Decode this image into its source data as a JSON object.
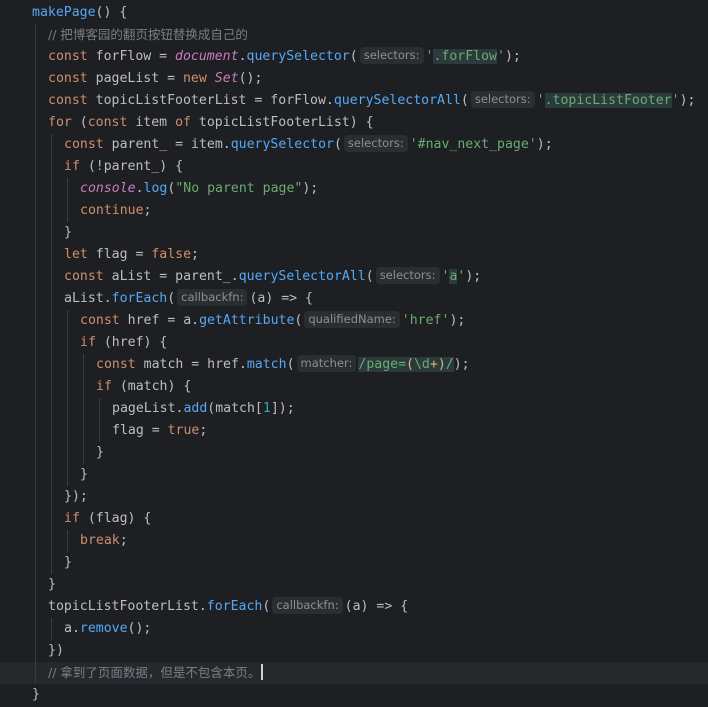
{
  "colors": {
    "background": "#1e1f22",
    "current_line": "#26282e",
    "keyword": "#cf8e6d",
    "function": "#56a8f5",
    "string": "#6aab73",
    "number": "#2aacb8",
    "comment": "#7a7e85",
    "global": "#c77dbb",
    "hint_bg": "#2b2d30"
  },
  "editor": {
    "lines": [
      [
        {
          "t": "makePage",
          "c": "fn"
        },
        {
          "t": "() {"
        }
      ],
      [
        {
          "t": "// 把博客园的翻页按钮替换成自己的",
          "c": "cmt"
        }
      ],
      [
        {
          "t": "const ",
          "c": "kw"
        },
        {
          "t": "forFlow = "
        },
        {
          "t": "document",
          "c": "pv"
        },
        {
          "t": "."
        },
        {
          "t": "querySelector",
          "c": "fn"
        },
        {
          "t": "("
        },
        {
          "t": "selectors:",
          "c": "hint"
        },
        {
          "t": "'",
          "c": "str"
        },
        {
          "t": ".forFlow",
          "c": "str inj"
        },
        {
          "t": "'",
          "c": "str"
        },
        {
          "t": ");"
        }
      ],
      [
        {
          "t": "const ",
          "c": "kw"
        },
        {
          "t": "pageList = "
        },
        {
          "t": "new ",
          "c": "kw"
        },
        {
          "t": "Set",
          "c": "cls"
        },
        {
          "t": "();"
        }
      ],
      [
        {
          "t": "const ",
          "c": "kw"
        },
        {
          "t": "topicListFooterList = forFlow."
        },
        {
          "t": "querySelectorAll",
          "c": "fn"
        },
        {
          "t": "("
        },
        {
          "t": "selectors:",
          "c": "hint"
        },
        {
          "t": "'",
          "c": "str"
        },
        {
          "t": ".topicListFooter",
          "c": "str inj"
        },
        {
          "t": "'",
          "c": "str"
        },
        {
          "t": ");"
        }
      ],
      [
        {
          "t": "for ",
          "c": "kw"
        },
        {
          "t": "("
        },
        {
          "t": "const ",
          "c": "kw"
        },
        {
          "t": "item "
        },
        {
          "t": "of ",
          "c": "kw"
        },
        {
          "t": "topicListFooterList) {"
        }
      ],
      [
        {
          "t": "const ",
          "c": "kw"
        },
        {
          "t": "parent_ = item."
        },
        {
          "t": "querySelector",
          "c": "fn"
        },
        {
          "t": "("
        },
        {
          "t": "selectors:",
          "c": "hint"
        },
        {
          "t": "'#nav_next_page'",
          "c": "str"
        },
        {
          "t": ");"
        }
      ],
      [
        {
          "t": "if ",
          "c": "kw"
        },
        {
          "t": "(!parent_) {"
        }
      ],
      [
        {
          "t": "console",
          "c": "pv"
        },
        {
          "t": "."
        },
        {
          "t": "log",
          "c": "fn"
        },
        {
          "t": "("
        },
        {
          "t": "\"No parent page\"",
          "c": "str"
        },
        {
          "t": ");"
        }
      ],
      [
        {
          "t": "continue",
          "c": "kw"
        },
        {
          "t": ";"
        }
      ],
      [
        {
          "t": "}"
        }
      ],
      [
        {
          "t": "let ",
          "c": "kw"
        },
        {
          "t": "flag = "
        },
        {
          "t": "false",
          "c": "kw"
        },
        {
          "t": ";"
        }
      ],
      [
        {
          "t": "const ",
          "c": "kw"
        },
        {
          "t": "aList = parent_."
        },
        {
          "t": "querySelectorAll",
          "c": "fn"
        },
        {
          "t": "("
        },
        {
          "t": "selectors:",
          "c": "hint"
        },
        {
          "t": "'",
          "c": "str"
        },
        {
          "t": "a",
          "c": "str inj"
        },
        {
          "t": "'",
          "c": "str"
        },
        {
          "t": ");"
        }
      ],
      [
        {
          "t": "aList."
        },
        {
          "t": "forEach",
          "c": "fn"
        },
        {
          "t": "("
        },
        {
          "t": "callbackfn:",
          "c": "hint"
        },
        {
          "t": "(a) => {"
        }
      ],
      [
        {
          "t": "const ",
          "c": "kw"
        },
        {
          "t": "href = a."
        },
        {
          "t": "getAttribute",
          "c": "fn"
        },
        {
          "t": "("
        },
        {
          "t": "qualifiedName:",
          "c": "hint"
        },
        {
          "t": "'href'",
          "c": "str"
        },
        {
          "t": ");"
        }
      ],
      [
        {
          "t": "if ",
          "c": "kw"
        },
        {
          "t": "(href) {"
        }
      ],
      [
        {
          "t": "const ",
          "c": "kw"
        },
        {
          "t": "match = href."
        },
        {
          "t": "match",
          "c": "fn"
        },
        {
          "t": "("
        },
        {
          "t": "matcher:",
          "c": "hint"
        },
        {
          "t": "/",
          "c": "rx"
        },
        {
          "t": "page=",
          "c": "rx"
        },
        {
          "t": "(",
          "c": "rxm"
        },
        {
          "t": "\\d",
          "c": "rx"
        },
        {
          "t": "+",
          "c": "rxm"
        },
        {
          "t": ")",
          "c": "rxm"
        },
        {
          "t": "/",
          "c": "rx"
        },
        {
          "t": ");"
        }
      ],
      [
        {
          "t": "if ",
          "c": "kw"
        },
        {
          "t": "(match) {"
        }
      ],
      [
        {
          "t": "pageList."
        },
        {
          "t": "add",
          "c": "fn"
        },
        {
          "t": "(match["
        },
        {
          "t": "1",
          "c": "num"
        },
        {
          "t": "]);"
        }
      ],
      [
        {
          "t": "flag = "
        },
        {
          "t": "true",
          "c": "kw"
        },
        {
          "t": ";"
        }
      ],
      [
        {
          "t": "}"
        }
      ],
      [
        {
          "t": "}"
        }
      ],
      [
        {
          "t": "});"
        }
      ],
      [
        {
          "t": "if ",
          "c": "kw"
        },
        {
          "t": "(flag) {"
        }
      ],
      [
        {
          "t": "break",
          "c": "kw"
        },
        {
          "t": ";"
        }
      ],
      [
        {
          "t": "}"
        }
      ],
      [
        {
          "t": "}"
        }
      ],
      [
        {
          "t": "topicListFooterList."
        },
        {
          "t": "forEach",
          "c": "fn"
        },
        {
          "t": "("
        },
        {
          "t": "callbackfn:",
          "c": "hint"
        },
        {
          "t": "(a) => {"
        }
      ],
      [
        {
          "t": "a."
        },
        {
          "t": "remove",
          "c": "fn"
        },
        {
          "t": "();"
        }
      ],
      [
        {
          "t": "})"
        }
      ],
      [
        {
          "t": "// 拿到了页面数据，但是不包含本页。",
          "c": "cmt"
        },
        {
          "t": "",
          "c": "caret"
        }
      ],
      [
        {
          "t": "}"
        }
      ]
    ]
  }
}
